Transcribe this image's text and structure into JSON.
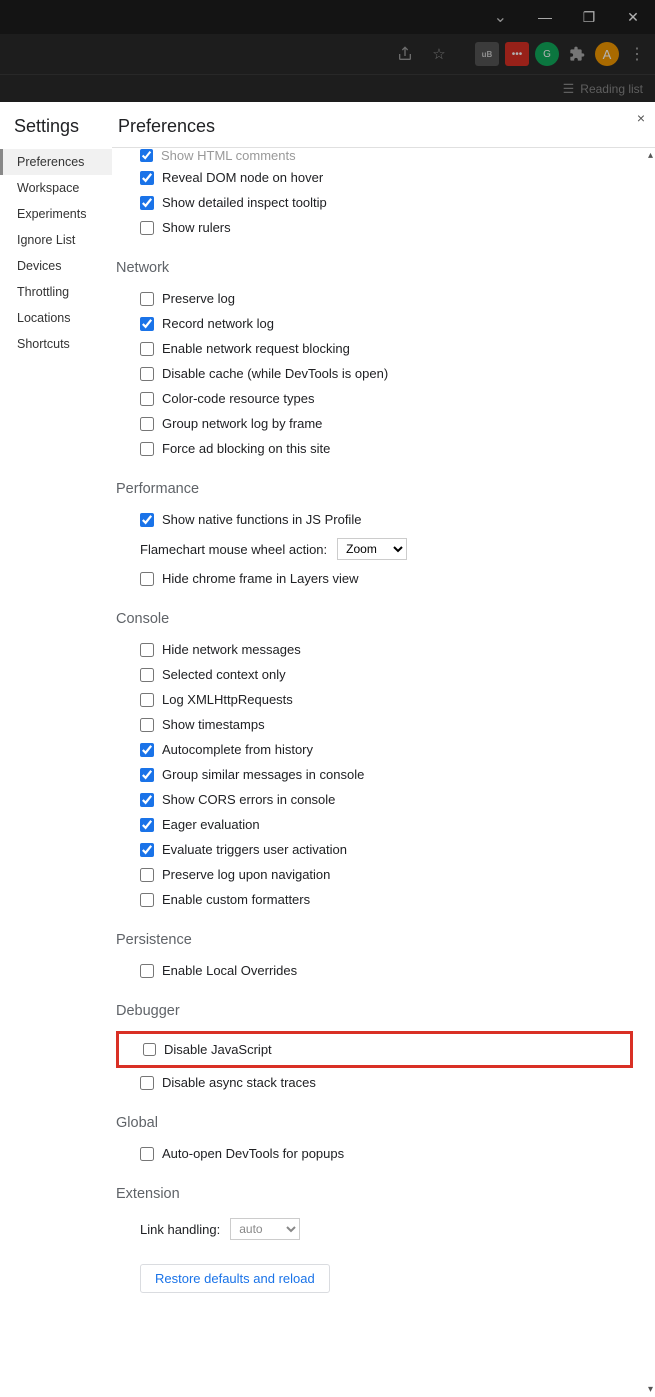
{
  "window_controls": {
    "minimize": "—",
    "maximize": "❐",
    "close": "✕",
    "dropdown": "⌄"
  },
  "toolbar": {
    "share_icon": "share-icon",
    "star_icon": "star-icon",
    "avatar_letter": "A",
    "reading_list_label": "Reading list"
  },
  "settings_title": "Settings",
  "page_title": "Preferences",
  "close_label": "×",
  "sidebar": [
    {
      "label": "Preferences",
      "active": true
    },
    {
      "label": "Workspace",
      "active": false
    },
    {
      "label": "Experiments",
      "active": false
    },
    {
      "label": "Ignore List",
      "active": false
    },
    {
      "label": "Devices",
      "active": false
    },
    {
      "label": "Throttling",
      "active": false
    },
    {
      "label": "Locations",
      "active": false
    },
    {
      "label": "Shortcuts",
      "active": false
    }
  ],
  "top_partial": {
    "label": "Show HTML comments",
    "checked": true
  },
  "elements_tail": [
    {
      "label": "Reveal DOM node on hover",
      "checked": true
    },
    {
      "label": "Show detailed inspect tooltip",
      "checked": true
    },
    {
      "label": "Show rulers",
      "checked": false
    }
  ],
  "sections": {
    "network": {
      "title": "Network",
      "items": [
        {
          "label": "Preserve log",
          "checked": false
        },
        {
          "label": "Record network log",
          "checked": true
        },
        {
          "label": "Enable network request blocking",
          "checked": false
        },
        {
          "label": "Disable cache (while DevTools is open)",
          "checked": false
        },
        {
          "label": "Color-code resource types",
          "checked": false
        },
        {
          "label": "Group network log by frame",
          "checked": false
        },
        {
          "label": "Force ad blocking on this site",
          "checked": false
        }
      ]
    },
    "performance": {
      "title": "Performance",
      "items_before": [
        {
          "label": "Show native functions in JS Profile",
          "checked": true
        }
      ],
      "flame_label": "Flamechart mouse wheel action:",
      "flame_value": "Zoom",
      "items_after": [
        {
          "label": "Hide chrome frame in Layers view",
          "checked": false
        }
      ]
    },
    "console": {
      "title": "Console",
      "items": [
        {
          "label": "Hide network messages",
          "checked": false
        },
        {
          "label": "Selected context only",
          "checked": false
        },
        {
          "label": "Log XMLHttpRequests",
          "checked": false
        },
        {
          "label": "Show timestamps",
          "checked": false
        },
        {
          "label": "Autocomplete from history",
          "checked": true
        },
        {
          "label": "Group similar messages in console",
          "checked": true
        },
        {
          "label": "Show CORS errors in console",
          "checked": true
        },
        {
          "label": "Eager evaluation",
          "checked": true
        },
        {
          "label": "Evaluate triggers user activation",
          "checked": true
        },
        {
          "label": "Preserve log upon navigation",
          "checked": false
        },
        {
          "label": "Enable custom formatters",
          "checked": false
        }
      ]
    },
    "persistence": {
      "title": "Persistence",
      "items": [
        {
          "label": "Enable Local Overrides",
          "checked": false
        }
      ]
    },
    "debugger": {
      "title": "Debugger",
      "highlighted": {
        "label": "Disable JavaScript",
        "checked": false
      },
      "items": [
        {
          "label": "Disable async stack traces",
          "checked": false
        }
      ]
    },
    "global": {
      "title": "Global",
      "items": [
        {
          "label": "Auto-open DevTools for popups",
          "checked": false
        }
      ]
    },
    "extension": {
      "title": "Extension",
      "link_label": "Link handling:",
      "link_value": "auto"
    }
  },
  "restore_label": "Restore defaults and reload"
}
